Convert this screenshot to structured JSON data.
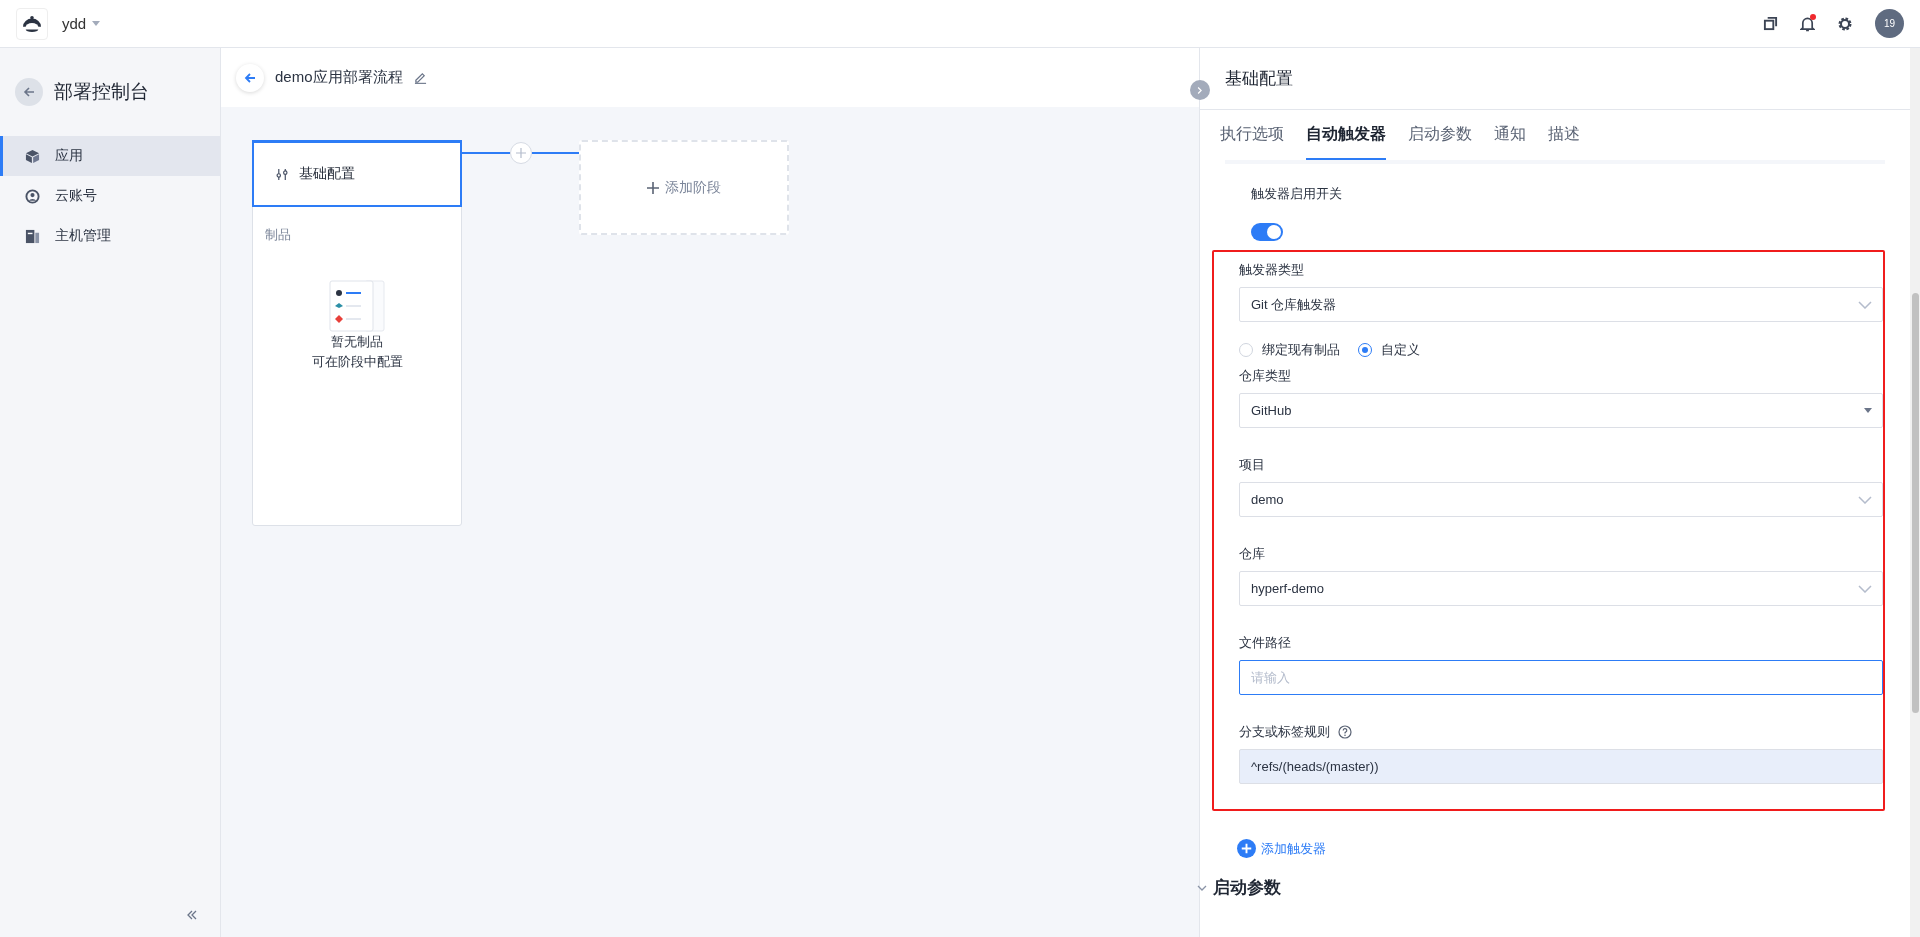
{
  "topbar": {
    "workspace": "ydd",
    "avatar": "19",
    "unread": true
  },
  "sidebar": {
    "title": "部署控制台",
    "items": [
      {
        "label": "应用",
        "selected": true,
        "kind": "cube"
      },
      {
        "label": "云账号",
        "selected": false,
        "kind": "account"
      },
      {
        "label": "主机管理",
        "selected": false,
        "kind": "server"
      }
    ]
  },
  "pipeline": {
    "title": "demo应用部署流程",
    "stage": {
      "title": "基础配置",
      "section": "制品",
      "empty_lines": [
        "暂无制品",
        "可在阶段中配置"
      ]
    },
    "add_stage": "添加阶段"
  },
  "panel": {
    "title": "基础配置",
    "tabs": [
      {
        "label": "执行选项",
        "selected": false
      },
      {
        "label": "自动触发器",
        "selected": true
      },
      {
        "label": "启动参数",
        "selected": false
      },
      {
        "label": "通知",
        "selected": false
      },
      {
        "label": "描述",
        "selected": false
      }
    ],
    "toggle": {
      "label": "触发器启用开关",
      "on": true
    },
    "trigger_type": {
      "label": "触发器类型",
      "value": "Git 仓库触发器"
    },
    "radios": [
      {
        "label": "绑定现有制品",
        "selected": false
      },
      {
        "label": "自定义",
        "selected": true
      }
    ],
    "fields": [
      {
        "label": "仓库类型",
        "value": "GitHub",
        "kind": "dropdown"
      },
      {
        "label": "项目",
        "value": "demo",
        "kind": "select"
      },
      {
        "label": "仓库",
        "value": "hyperf-demo",
        "kind": "select"
      },
      {
        "label": "文件路径",
        "placeholder": "请输入",
        "kind": "input"
      },
      {
        "label": "分支或标签规则",
        "value": "^refs/(heads/(master))",
        "kind": "readonly",
        "help": true
      }
    ],
    "add_trigger": "添加触发器",
    "section": "启动参数"
  }
}
